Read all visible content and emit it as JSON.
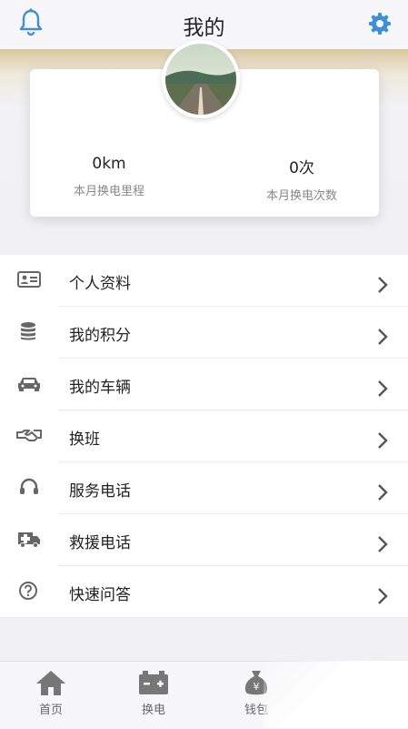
{
  "header": {
    "title": "我的",
    "left_icon": "bell-icon",
    "right_icon": "gear-icon",
    "accent_color": "#3d8fd6"
  },
  "profile": {
    "stats": [
      {
        "value": "0km",
        "label": "本月换电里程"
      },
      {
        "value": "0次",
        "label": "本月换电次数"
      }
    ]
  },
  "menu": {
    "items": [
      {
        "label": "个人资料",
        "icon": "id-card-icon"
      },
      {
        "label": "我的积分",
        "icon": "coins-stack-icon"
      },
      {
        "label": "我的车辆",
        "icon": "car-icon"
      },
      {
        "label": "换班",
        "icon": "handshake-icon"
      },
      {
        "label": "服务电话",
        "icon": "headset-icon"
      },
      {
        "label": "救援电话",
        "icon": "ambulance-icon"
      },
      {
        "label": "快速问答",
        "icon": "question-icon"
      }
    ]
  },
  "tabbar": {
    "tabs": [
      {
        "label": "首页",
        "icon": "home-icon"
      },
      {
        "label": "换电",
        "icon": "battery-icon"
      },
      {
        "label": "钱包",
        "icon": "money-bag-icon"
      }
    ]
  }
}
